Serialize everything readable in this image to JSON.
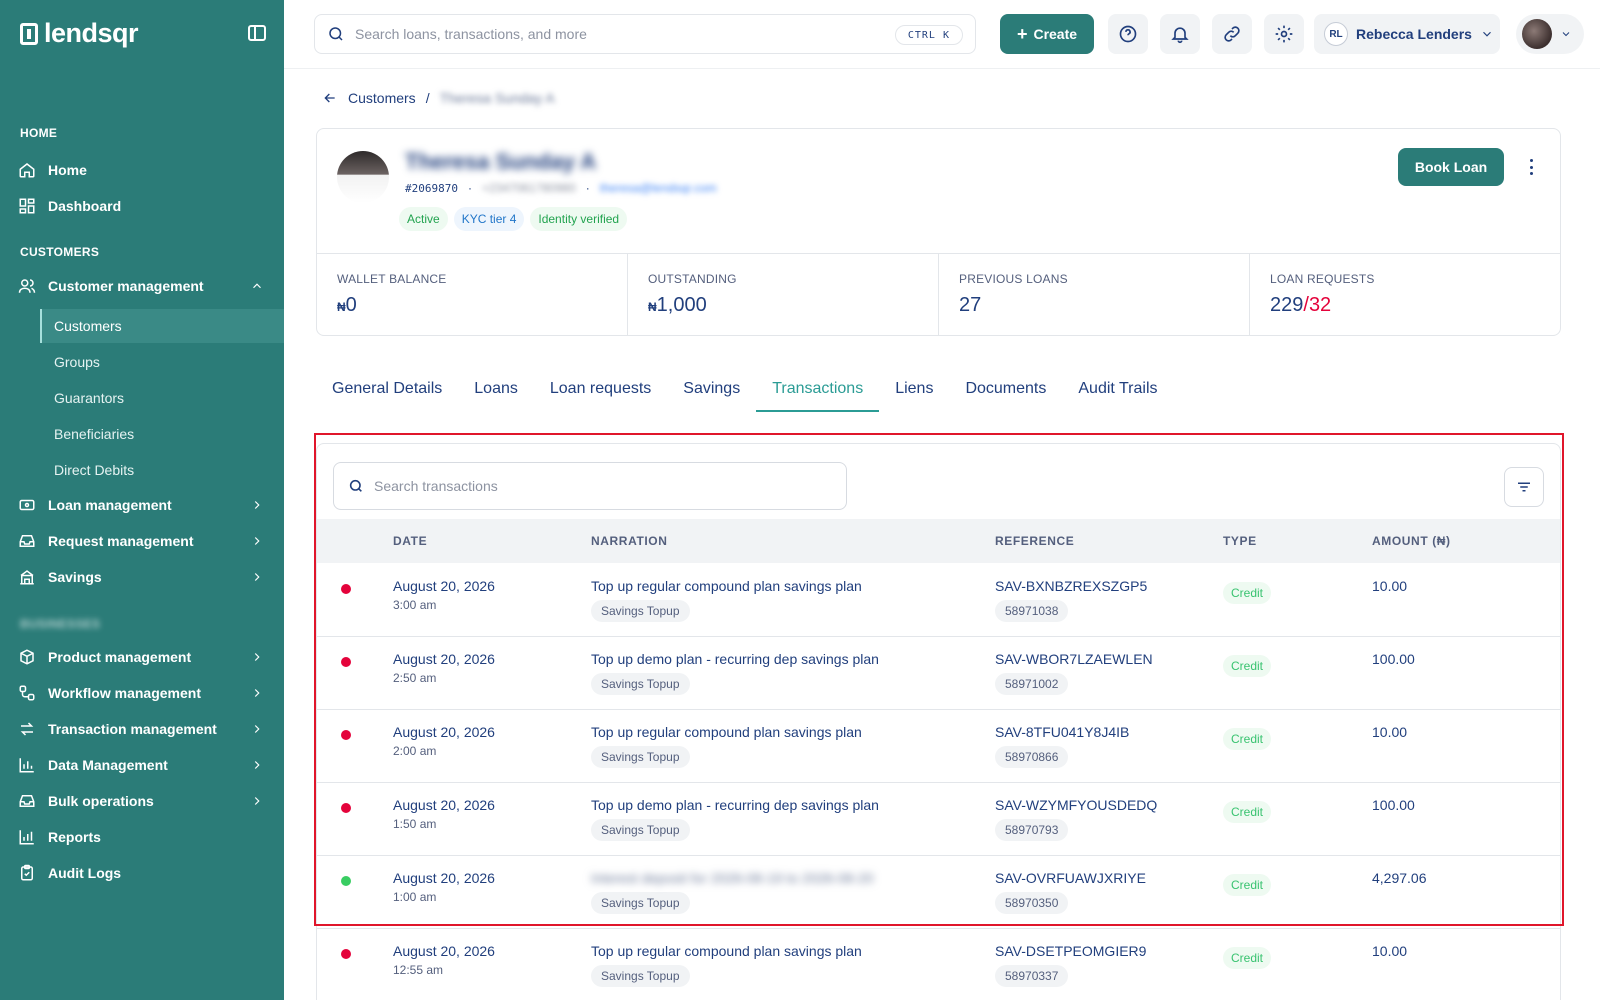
{
  "sidebar": {
    "logo_text": "lendsqr",
    "sections": [
      "HOME",
      "CUSTOMERS",
      "BUSINESSES"
    ],
    "home_items": [
      {
        "label": "Home",
        "icon": "home-icon"
      },
      {
        "label": "Dashboard",
        "icon": "dashboard-icon"
      }
    ],
    "customer_management": "Customer management",
    "customer_sub_items": [
      "Customers",
      "Groups",
      "Guarantors",
      "Beneficiaries",
      "Direct Debits"
    ],
    "customer_items": [
      {
        "label": "Loan management",
        "icon": "loan-icon"
      },
      {
        "label": "Request management",
        "icon": "inbox-icon"
      },
      {
        "label": "Savings",
        "icon": "savings-icon"
      }
    ],
    "business_items": [
      {
        "label": "Product management",
        "icon": "box-icon"
      },
      {
        "label": "Workflow management",
        "icon": "workflow-icon"
      },
      {
        "label": "Transaction management",
        "icon": "transfer-icon"
      },
      {
        "label": "Data Management",
        "icon": "chart-icon"
      },
      {
        "label": "Bulk operations",
        "icon": "inbox-icon"
      },
      {
        "label": "Reports",
        "icon": "report-icon"
      },
      {
        "label": "Audit Logs",
        "icon": "clipboard-icon"
      }
    ]
  },
  "topbar": {
    "search_placeholder": "Search loans, transactions, and more",
    "shortcut": "CTRL K",
    "create_label": "Create",
    "user_initials": "RL",
    "user_name": "Rebecca Lenders"
  },
  "breadcrumb": {
    "parent": "Customers",
    "separator": "/",
    "current": "Theresa Sunday A"
  },
  "customer": {
    "name": "Theresa Sunday A",
    "id": "#2069870",
    "phone": "+2347061780980",
    "email": "theresa@lendsqr.com",
    "badges": [
      "Active",
      "KYC tier 4",
      "Identity verified"
    ],
    "book_loan_label": "Book Loan"
  },
  "stats": {
    "wallet_label": "WALLET BALANCE",
    "wallet_currency": "₦",
    "wallet_value": "0",
    "outstanding_label": "OUTSTANDING",
    "outstanding_currency": "₦",
    "outstanding_value": "1,000",
    "previous_label": "PREVIOUS LOANS",
    "previous_value": "27",
    "requests_label": "LOAN REQUESTS",
    "requests_total": "229",
    "requests_sep": "/",
    "requests_pending": "32"
  },
  "tabs": [
    "General Details",
    "Loans",
    "Loan requests",
    "Savings",
    "Transactions",
    "Liens",
    "Documents",
    "Audit Trails"
  ],
  "active_tab": "Transactions",
  "transactions": {
    "search_placeholder": "Search transactions",
    "columns": [
      "DATE",
      "NARRATION",
      "REFERENCE",
      "TYPE",
      "AMOUNT (₦)"
    ],
    "rows": [
      {
        "status": "red",
        "date": "August 20, 2026",
        "time": "3:00 am",
        "narration": "Top up regular compound plan savings plan",
        "category": "Savings Topup",
        "reference": "SAV-BXNBZREXSZGP5",
        "ref_id": "58971038",
        "type": "Credit",
        "amount": "10.00"
      },
      {
        "status": "red",
        "date": "August 20, 2026",
        "time": "2:50 am",
        "narration": "Top up demo plan - recurring dep savings plan",
        "category": "Savings Topup",
        "reference": "SAV-WBOR7LZAEWLEN",
        "ref_id": "58971002",
        "type": "Credit",
        "amount": "100.00"
      },
      {
        "status": "red",
        "date": "August 20, 2026",
        "time": "2:00 am",
        "narration": "Top up regular compound plan savings plan",
        "category": "Savings Topup",
        "reference": "SAV-8TFU041Y8J4IB",
        "ref_id": "58970866",
        "type": "Credit",
        "amount": "10.00"
      },
      {
        "status": "red",
        "date": "August 20, 2026",
        "time": "1:50 am",
        "narration": "Top up demo plan - recurring dep savings plan",
        "category": "Savings Topup",
        "reference": "SAV-WZYMFYOUSDEDQ",
        "ref_id": "58970793",
        "type": "Credit",
        "amount": "100.00"
      },
      {
        "status": "green",
        "date": "August 20, 2026",
        "time": "1:00 am",
        "narration": "Interest deposit for 2026-08-19 to 2026-08-20",
        "category": "Savings Topup",
        "reference": "SAV-OVRFUAWJXRIYE",
        "ref_id": "58970350",
        "type": "Credit",
        "amount": "4,297.06",
        "narration_blurred": true
      },
      {
        "status": "red",
        "date": "August 20, 2026",
        "time": "12:55 am",
        "narration": "Top up regular compound plan savings plan",
        "category": "Savings Topup",
        "reference": "SAV-DSETPEOMGIER9",
        "ref_id": "58970337",
        "type": "Credit",
        "amount": "10.00"
      }
    ]
  },
  "colors": {
    "brand": "#2b7c78",
    "text": "#213f7d",
    "red_dot": "#e4033b",
    "green_dot": "#39cd62",
    "highlight": "#e0162b"
  }
}
